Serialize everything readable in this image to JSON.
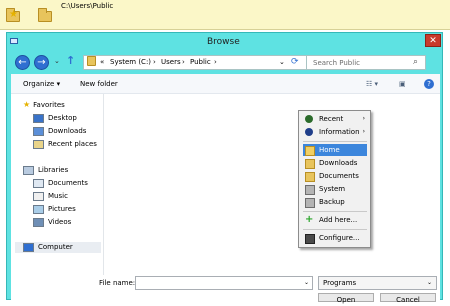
{
  "topbar": {
    "path": "C:\\Users\\Public"
  },
  "dialog": {
    "title": "Browse",
    "close_glyph": "✕",
    "nav": {
      "back_glyph": "←",
      "forward_glyph": "→",
      "dropdown_glyph": "⌄",
      "up_glyph": "↑",
      "breadcrumb": [
        "«",
        "System (C:)",
        "›",
        "Users",
        "›",
        "Public",
        "›"
      ],
      "address_dropdown": "⌄",
      "refresh_glyph": "⟳",
      "search_placeholder": "Search Public",
      "search_glyph": "⌕"
    },
    "toolbar": {
      "organize": "Organize ▾",
      "new_folder": "New folder",
      "view_glyph": "☷ ▾",
      "pane_glyph": "▣",
      "help_glyph": "?"
    },
    "sidebar": {
      "favorites_header": "Favorites",
      "favorites": [
        "Desktop",
        "Downloads",
        "Recent places"
      ],
      "libraries_header": "Libraries",
      "libraries": [
        "Documents",
        "Music",
        "Pictures",
        "Videos"
      ],
      "computer": "Computer"
    },
    "bottom": {
      "file_name_label": "File name:",
      "file_name_value": "",
      "filter_value": "Programs",
      "open": "Open",
      "cancel": "Cancel"
    }
  },
  "popup": {
    "items_top": [
      {
        "label": "Recent",
        "icon": "clock-icon",
        "arrow": "›"
      },
      {
        "label": "Information",
        "icon": "info-icon",
        "arrow": "›"
      }
    ],
    "items_places": [
      {
        "label": "Home",
        "icon": "folder-icon",
        "selected": true
      },
      {
        "label": "Downloads",
        "icon": "folder-icon"
      },
      {
        "label": "Documents",
        "icon": "folder-icon"
      },
      {
        "label": "System",
        "icon": "drive-icon"
      },
      {
        "label": "Backup",
        "icon": "drive-icon"
      }
    ],
    "items_actions": [
      {
        "label": "Add here...",
        "icon": "plus-icon"
      }
    ],
    "items_config": [
      {
        "label": "Configure...",
        "icon": "config-icon"
      }
    ],
    "colors": {
      "selected_bg": "#3c86dc",
      "accent_cyan": "#5ee2e2"
    }
  }
}
